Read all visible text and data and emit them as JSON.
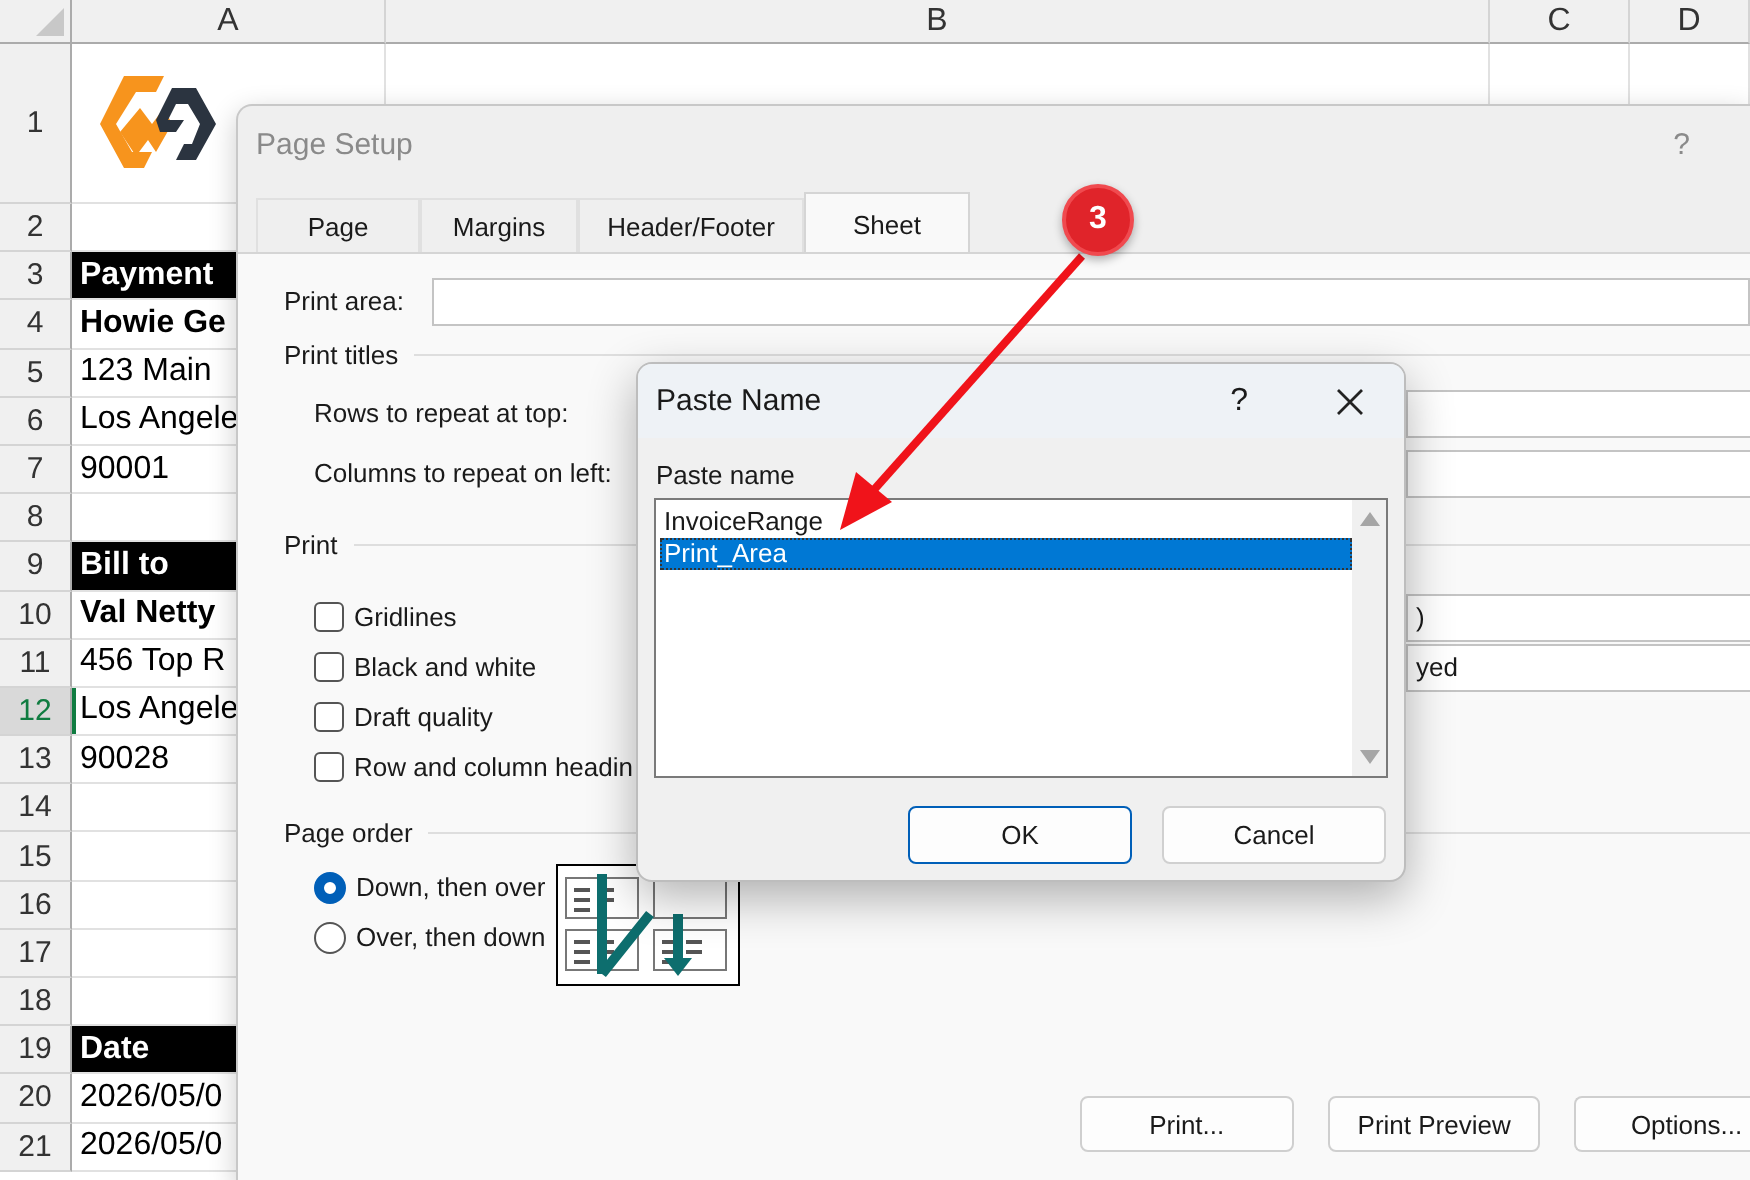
{
  "sheet": {
    "columns": [
      "A",
      "B",
      "C",
      "D"
    ],
    "rows": [
      {
        "number": "1",
        "kind": "logo",
        "selected": false
      },
      {
        "number": "2",
        "kind": "blank",
        "selected": false
      },
      {
        "number": "3",
        "kind": "heading",
        "text": "Payment",
        "selected": false
      },
      {
        "number": "4",
        "kind": "bold",
        "text": "Howie Ge",
        "selected": false
      },
      {
        "number": "5",
        "kind": "plain",
        "text": "123 Main",
        "selected": false
      },
      {
        "number": "6",
        "kind": "plain",
        "text": "Los Angele",
        "selected": false
      },
      {
        "number": "7",
        "kind": "plain",
        "text": "90001",
        "selected": false
      },
      {
        "number": "8",
        "kind": "blank",
        "selected": false
      },
      {
        "number": "9",
        "kind": "heading",
        "text": "Bill to",
        "selected": false
      },
      {
        "number": "10",
        "kind": "bold",
        "text": "Val Netty",
        "selected": false
      },
      {
        "number": "11",
        "kind": "plain",
        "text": "456 Top R",
        "selected": false
      },
      {
        "number": "12",
        "kind": "plain",
        "text": "Los Angele",
        "selected": true
      },
      {
        "number": "13",
        "kind": "plain",
        "text": "90028",
        "selected": false
      },
      {
        "number": "14",
        "kind": "blank",
        "selected": false
      },
      {
        "number": "15",
        "kind": "blank",
        "selected": false
      },
      {
        "number": "16",
        "kind": "blank",
        "selected": false
      },
      {
        "number": "17",
        "kind": "blank",
        "selected": false
      },
      {
        "number": "18",
        "kind": "blank",
        "selected": false
      },
      {
        "number": "19",
        "kind": "heading",
        "text": "Date",
        "selected": false
      },
      {
        "number": "20",
        "kind": "plain",
        "text": "2026/05/0",
        "selected": false
      },
      {
        "number": "21",
        "kind": "plain",
        "text": "2026/05/0",
        "selected": false
      }
    ]
  },
  "page_setup": {
    "title": "Page Setup",
    "help": "?",
    "tabs": [
      {
        "label": "Page",
        "selected": false
      },
      {
        "label": "Margins",
        "selected": false
      },
      {
        "label": "Header/Footer",
        "selected": false
      },
      {
        "label": "Sheet",
        "selected": true
      }
    ],
    "print_area": {
      "label": "Print area:"
    },
    "print_titles": {
      "label": "Print titles",
      "rows_label": "Rows to repeat at top:",
      "columns_label": "Columns to repeat on left:"
    },
    "print": {
      "label": "Print",
      "options": [
        {
          "label": "Gridlines",
          "checked": false
        },
        {
          "label": "Black and white",
          "checked": false
        },
        {
          "label": "Draft quality",
          "checked": false
        },
        {
          "label": "Row and column headin",
          "checked": false
        }
      ],
      "field_1_text": ")",
      "field_2_text": "yed"
    },
    "page_order": {
      "label": "Page order",
      "options": [
        {
          "label": "Down, then over",
          "selected": true
        },
        {
          "label": "Over, then down",
          "selected": false
        }
      ]
    },
    "buttons": [
      "Print...",
      "Print Preview",
      "Options..."
    ]
  },
  "paste_name": {
    "title": "Paste Name",
    "help": "?",
    "list_label": "Paste name",
    "items": [
      {
        "label": "InvoiceRange",
        "selected": false
      },
      {
        "label": "Print_Area",
        "selected": true
      }
    ],
    "buttons": [
      {
        "label": "OK",
        "default": true
      },
      {
        "label": "Cancel",
        "default": false
      }
    ]
  },
  "callout": {
    "number": "3"
  }
}
